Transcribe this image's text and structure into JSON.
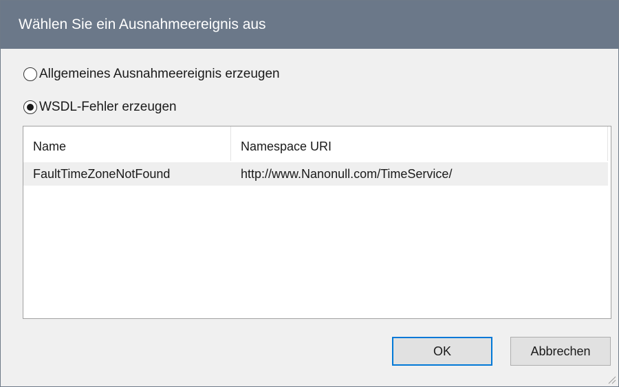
{
  "dialog": {
    "title": "Wählen Sie ein Ausnahmeereignis aus"
  },
  "options": {
    "general": {
      "label": "Allgemeines Ausnahmeereignis erzeugen",
      "selected": false
    },
    "wsdl": {
      "label": "WSDL-Fehler erzeugen",
      "selected": true
    }
  },
  "faults_list": {
    "columns": [
      "Name",
      "Namespace URI"
    ],
    "rows": [
      {
        "name": "FaultTimeZoneNotFound",
        "namespace": "http://www.Nanonull.com/TimeService/"
      }
    ]
  },
  "buttons": {
    "ok": "OK",
    "cancel": "Abbrechen"
  },
  "colors": {
    "titlebar": "#6b7889",
    "focus_border": "#0078d7",
    "selected_row": "#efefef"
  }
}
